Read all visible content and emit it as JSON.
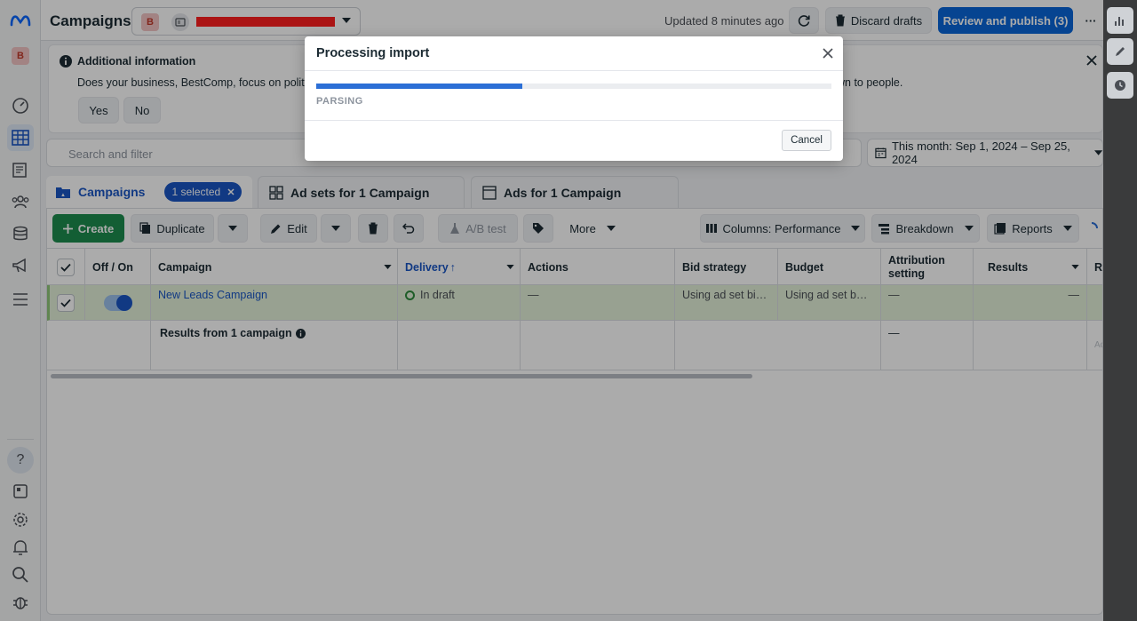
{
  "header": {
    "title": "Campaigns",
    "account_initial": "B",
    "updated_text": "Updated 8 minutes ago",
    "discard_label": "Discard drafts",
    "review_label": "Review and publish (3)",
    "more_label": "···"
  },
  "banner": {
    "title": "Additional information",
    "body_start": "Does your business, BestComp, focus on politic",
    "body_end": "wn to people.",
    "yes_label": "Yes",
    "no_label": "No"
  },
  "search": {
    "placeholder": "Search and filter"
  },
  "date_range": {
    "label": "This month: Sep 1, 2024 – Sep 25, 2024"
  },
  "tabs": {
    "campaigns": "Campaigns",
    "selected_chip": "1 selected",
    "adsets": "Ad sets for 1 Campaign",
    "ads": "Ads for 1 Campaign"
  },
  "toolbar": {
    "create": "Create",
    "duplicate": "Duplicate",
    "edit": "Edit",
    "ab_test": "A/B test",
    "more": "More",
    "columns": "Columns: Performance",
    "breakdown": "Breakdown",
    "reports": "Reports"
  },
  "table": {
    "headers": {
      "off_on": "Off / On",
      "campaign": "Campaign",
      "delivery": "Delivery",
      "actions": "Actions",
      "bid_strategy": "Bid strategy",
      "budget": "Budget",
      "attribution_1": "Attribution",
      "attribution_2": "setting",
      "results": "Results",
      "reach_partial": "Re"
    },
    "row": {
      "campaign": "New Leads Campaign",
      "delivery": "In draft",
      "actions": "—",
      "bid_strategy": "Using ad set bid …",
      "budget": "Using ad set bud…",
      "attribution": "—",
      "results": "—"
    },
    "summary": {
      "label": "Results from 1 campaign",
      "attribution": "—",
      "partial": "Ac"
    }
  },
  "modal": {
    "title": "Processing import",
    "status": "PARSING",
    "progress": 0.4,
    "cancel_label": "Cancel"
  },
  "colors": {
    "primary": "#0a66d8",
    "create_green": "#1d8c4e",
    "selected_row": "#e3f1d9",
    "progress": "#2c6fd6"
  }
}
